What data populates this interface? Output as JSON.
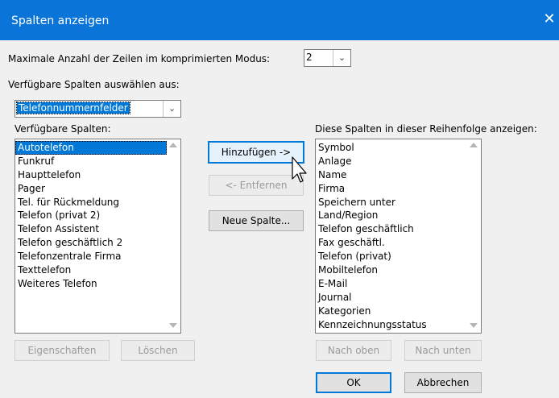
{
  "window": {
    "title": "Spalten anzeigen",
    "close_glyph": "✕"
  },
  "max_rows": {
    "label": "Maximale Anzahl der Zeilen im komprimierten Modus:",
    "value": "2"
  },
  "source": {
    "label": "Verfügbare Spalten auswählen aus:",
    "value": "Telefonnummernfelder"
  },
  "available": {
    "label": "Verfügbare Spalten:",
    "items": [
      "Autotelefon",
      "Funkruf",
      "Haupttelefon",
      "Pager",
      "Tel. für Rückmeldung",
      "Telefon (privat 2)",
      "Telefon Assistent",
      "Telefon geschäftlich 2",
      "Telefonzentrale Firma",
      "Texttelefon",
      "Weiteres Telefon"
    ],
    "selected_index": 0
  },
  "shown": {
    "label": "Diese Spalten in dieser Reihenfolge anzeigen:",
    "items": [
      "Symbol",
      "Anlage",
      "Name",
      "Firma",
      "Speichern unter",
      "Land/Region",
      "Telefon geschäftlich",
      "Fax geschäftl.",
      "Telefon (privat)",
      "Mobiltelefon",
      "E-Mail",
      "Journal",
      "Kategorien",
      "Kennzeichnungsstatus"
    ]
  },
  "buttons": {
    "add": "Hinzufügen ->",
    "remove": "<- Entfernen",
    "new_column": "Neue Spalte...",
    "properties": "Eigenschaften",
    "delete": "Löschen",
    "move_up": "Nach oben",
    "move_down": "Nach unten",
    "ok": "OK",
    "cancel": "Abbrechen"
  },
  "icons": {
    "dropdown": "chevron-down-icon",
    "cursor": "mouse-pointer-icon"
  },
  "colors": {
    "titlebar": "#0a74d9",
    "selection": "#0078d7"
  }
}
